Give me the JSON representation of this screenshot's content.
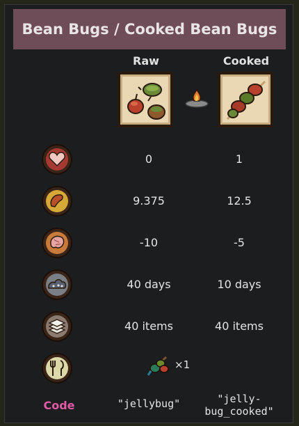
{
  "title": "Bean Bugs / Cooked Bean Bugs",
  "columns": {
    "raw": "Raw",
    "cooked": "Cooked"
  },
  "stats": [
    {
      "icon": "health-icon",
      "raw": "0",
      "cooked": "1"
    },
    {
      "icon": "hunger-icon",
      "raw": "9.375",
      "cooked": "12.5"
    },
    {
      "icon": "sanity-icon",
      "raw": "-10",
      "cooked": "-5"
    },
    {
      "icon": "spoilage-icon",
      "raw": "40 days",
      "cooked": "10 days"
    },
    {
      "icon": "stack-icon",
      "raw": "40 items",
      "cooked": "40 items"
    }
  ],
  "food_type": {
    "icon": "food-type-icon",
    "quantity": "×1"
  },
  "code": {
    "label": "Code",
    "raw": "\"jellybug\"",
    "cooked_line1": "\"jelly-",
    "cooked_line2": "bug_cooked\""
  },
  "colors": {
    "title_bg": "#6e4d58",
    "code_label": "#e05aa6",
    "panel_bg": "#1c1d1f"
  }
}
